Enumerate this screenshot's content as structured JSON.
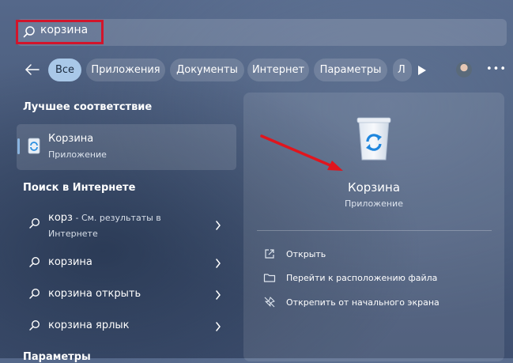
{
  "search": {
    "query": "корзина"
  },
  "tabs": [
    {
      "label": "Все",
      "active": true
    },
    {
      "label": "Приложения"
    },
    {
      "label": "Документы"
    },
    {
      "label": "Интернет"
    },
    {
      "label": "Параметры"
    },
    {
      "label": "Л"
    }
  ],
  "sections": {
    "best_match": "Лучшее соответствие",
    "web_search": "Поиск в Интернете",
    "settings": "Параметры"
  },
  "best_match": {
    "name": "Корзина",
    "type": "Приложение"
  },
  "web_results": [
    {
      "term": "корз",
      "suffix": " - См. результаты в",
      "second_line": "Интернете"
    },
    {
      "term": "корзина"
    },
    {
      "term": "корзина открыть"
    },
    {
      "term": "корзина ярлык"
    }
  ],
  "detail": {
    "name": "Корзина",
    "type": "Приложение",
    "actions": [
      {
        "label": "Открыть",
        "icon": "open-external-icon"
      },
      {
        "label": "Перейти к расположению файла",
        "icon": "folder-icon"
      },
      {
        "label": "Открепить от начального экрана",
        "icon": "unpin-icon"
      }
    ]
  },
  "colors": {
    "highlight": "#d2152b",
    "active_tab": "#a9c8e8",
    "accent": "#8ab4e0"
  }
}
